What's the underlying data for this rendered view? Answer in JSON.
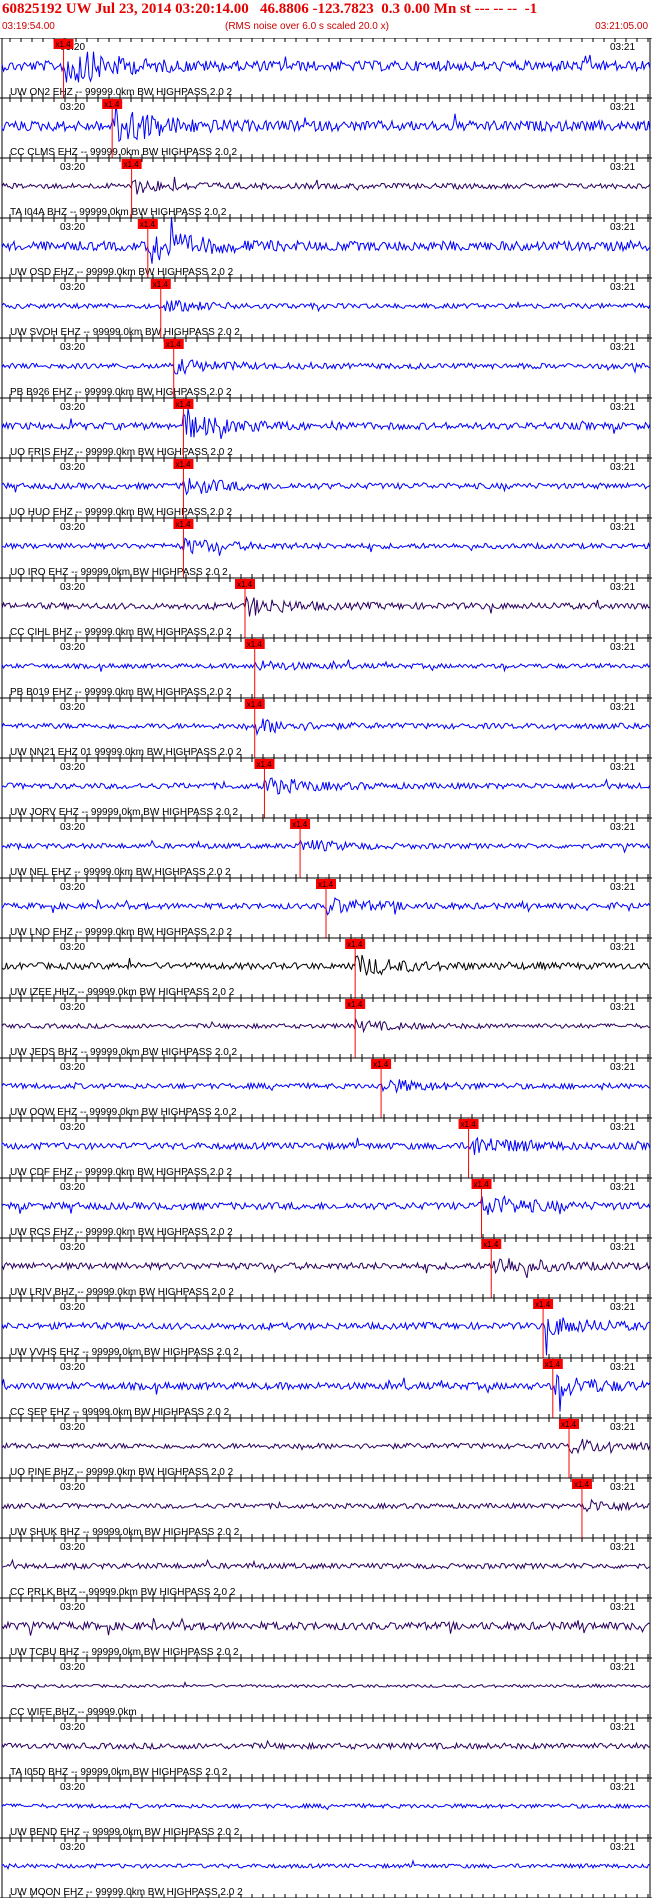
{
  "header": {
    "title": "60825192 UW Jul 23, 2014 03:20:14.00   46.8806 -123.7823  0.3 0.00 Mn st --- -- --  -1",
    "start_time": "03:19:54.00",
    "note": "(RMS noise over 6.0 s scaled 20.0 x)",
    "end_time": "03:21:05.00"
  },
  "minute_labels": {
    "left": "03:20",
    "right": "03:21"
  },
  "pick_label": "x1.4",
  "colors": {
    "header_text": "#e60000",
    "pick": "#ff0000",
    "trace_blue": "#0000ff",
    "trace_purple": "#2a0060",
    "trace_black": "#000000"
  },
  "traces": [
    {
      "label": "UW ON2 EHZ -- 99999.0km BW HIGHPASS  2.0  2",
      "color": "blue",
      "pick": 0.095,
      "amp": 0.9
    },
    {
      "label": "CC CLMS EHZ -- 99999.0km BW HIGHPASS  2.0  2",
      "color": "blue",
      "pick": 0.17,
      "amp": 0.9
    },
    {
      "label": "TA I04A BHZ -- 99999.0km BW HIGHPASS  2.0  2",
      "color": "purple",
      "pick": 0.2,
      "amp": 0.3
    },
    {
      "label": "UW OSD EHZ -- 99999.0km BW HIGHPASS  2.0  2",
      "color": "blue",
      "pick": 0.225,
      "amp": 0.8
    },
    {
      "label": "UW SVOH EHZ -- 99999.0km BW HIGHPASS  2.0  2",
      "color": "blue",
      "pick": 0.245,
      "amp": 0.25
    },
    {
      "label": "PB B926 EHZ -- 99999.0km BW HIGHPASS  2.0  2",
      "color": "blue",
      "pick": 0.265,
      "amp": 0.3
    },
    {
      "label": "UO FRIS EHZ -- 99999.0km BW HIGHPASS  2.0  2",
      "color": "blue",
      "pick": 0.28,
      "amp": 0.5
    },
    {
      "label": "UO HUO EHZ -- 99999.0km BW HIGHPASS  2.0  2",
      "color": "blue",
      "pick": 0.28,
      "amp": 0.35
    },
    {
      "label": "UO IRO EHZ -- 99999.0km BW HIGHPASS  2.0  2",
      "color": "blue",
      "pick": 0.28,
      "amp": 0.3
    },
    {
      "label": "CC CIHL BHZ -- 99999.0km BW HIGHPASS  2.0  2",
      "color": "purple",
      "pick": 0.375,
      "amp": 0.4
    },
    {
      "label": "PB B019 EHZ -- 99999.0km BW HIGHPASS  2.0  2",
      "color": "blue",
      "pick": 0.39,
      "amp": 0.2
    },
    {
      "label": "UW NN21 EHZ 01 99999.0km BW HIGHPASS  2.0  2",
      "color": "blue",
      "pick": 0.39,
      "amp": 0.3
    },
    {
      "label": "UW JORV EHZ -- 99999.0km BW HIGHPASS  2.0  2",
      "color": "blue",
      "pick": 0.405,
      "amp": 0.35
    },
    {
      "label": "UW NEL EHZ -- 99999.0km BW HIGHPASS  2.0  2",
      "color": "blue",
      "pick": 0.46,
      "amp": 0.25
    },
    {
      "label": "UW LNO EHZ -- 99999.0km BW HIGHPASS  2.0  2",
      "color": "blue",
      "pick": 0.5,
      "amp": 0.35
    },
    {
      "label": "UW IZEE HHZ -- 99999.0km BW HIGHPASS  2.0  2",
      "color": "black",
      "pick": 0.545,
      "amp": 0.45
    },
    {
      "label": "UW JEDS BHZ -- 99999.0km BW HIGHPASS  2.0  2",
      "color": "purple",
      "pick": 0.545,
      "amp": 0.2
    },
    {
      "label": "UW OOW EHZ -- 99999.0km BW HIGHPASS  2.0  2",
      "color": "blue",
      "pick": 0.585,
      "amp": 0.3
    },
    {
      "label": "UW CDF EHZ -- 99999.0km BW HIGHPASS  2.0  2",
      "color": "blue",
      "pick": 0.72,
      "amp": 0.45
    },
    {
      "label": "UW RCS EHZ -- 99999.0km BW HIGHPASS  2.0  2",
      "color": "blue",
      "pick": 0.74,
      "amp": 0.5
    },
    {
      "label": "UW LRIV BHZ -- 99999.0km BW HIGHPASS  2.0  2",
      "color": "purple",
      "pick": 0.755,
      "amp": 0.45
    },
    {
      "label": "UW VVHS EHZ -- 99999.0km BW HIGHPASS  2.0  2",
      "color": "blue",
      "pick": 0.835,
      "amp": 0.45
    },
    {
      "label": "CC SEP EHZ -- 99999.0km BW HIGHPASS  2.0  2",
      "color": "blue",
      "pick": 0.85,
      "amp": 0.5
    },
    {
      "label": "UO PINE BHZ -- 99999.0km BW HIGHPASS  2.0  2",
      "color": "purple",
      "pick": 0.875,
      "amp": 0.3
    },
    {
      "label": "UW SHUK BHZ -- 99999.0km BW HIGHPASS  2.0  2",
      "color": "purple",
      "pick": 0.895,
      "amp": 0.25
    },
    {
      "label": "CC PRLK BHZ -- 99999.0km BW HIGHPASS  2.0  2",
      "color": "purple",
      "pick": null,
      "amp": 0.3
    },
    {
      "label": "UW TCBU BHZ -- 99999.0km BW HIGHPASS  2.0  2",
      "color": "purple",
      "pick": null,
      "amp": 0.6
    },
    {
      "label": "CC WIFE BHZ -- 99999.0km",
      "color": "purple",
      "pick": null,
      "amp": 0.0
    },
    {
      "label": "TA I05D BHZ -- 99999.0km BW HIGHPASS  2.0  2",
      "color": "purple",
      "pick": null,
      "amp": 0.35
    },
    {
      "label": "UW BEND EHZ -- 99999.0km BW HIGHPASS  2.0  2",
      "color": "blue",
      "pick": null,
      "amp": 0.15
    },
    {
      "label": "UW MOON EHZ -- 99999.0km BW HIGHPASS  2.0  2",
      "color": "blue",
      "pick": null,
      "amp": 0.15
    }
  ]
}
